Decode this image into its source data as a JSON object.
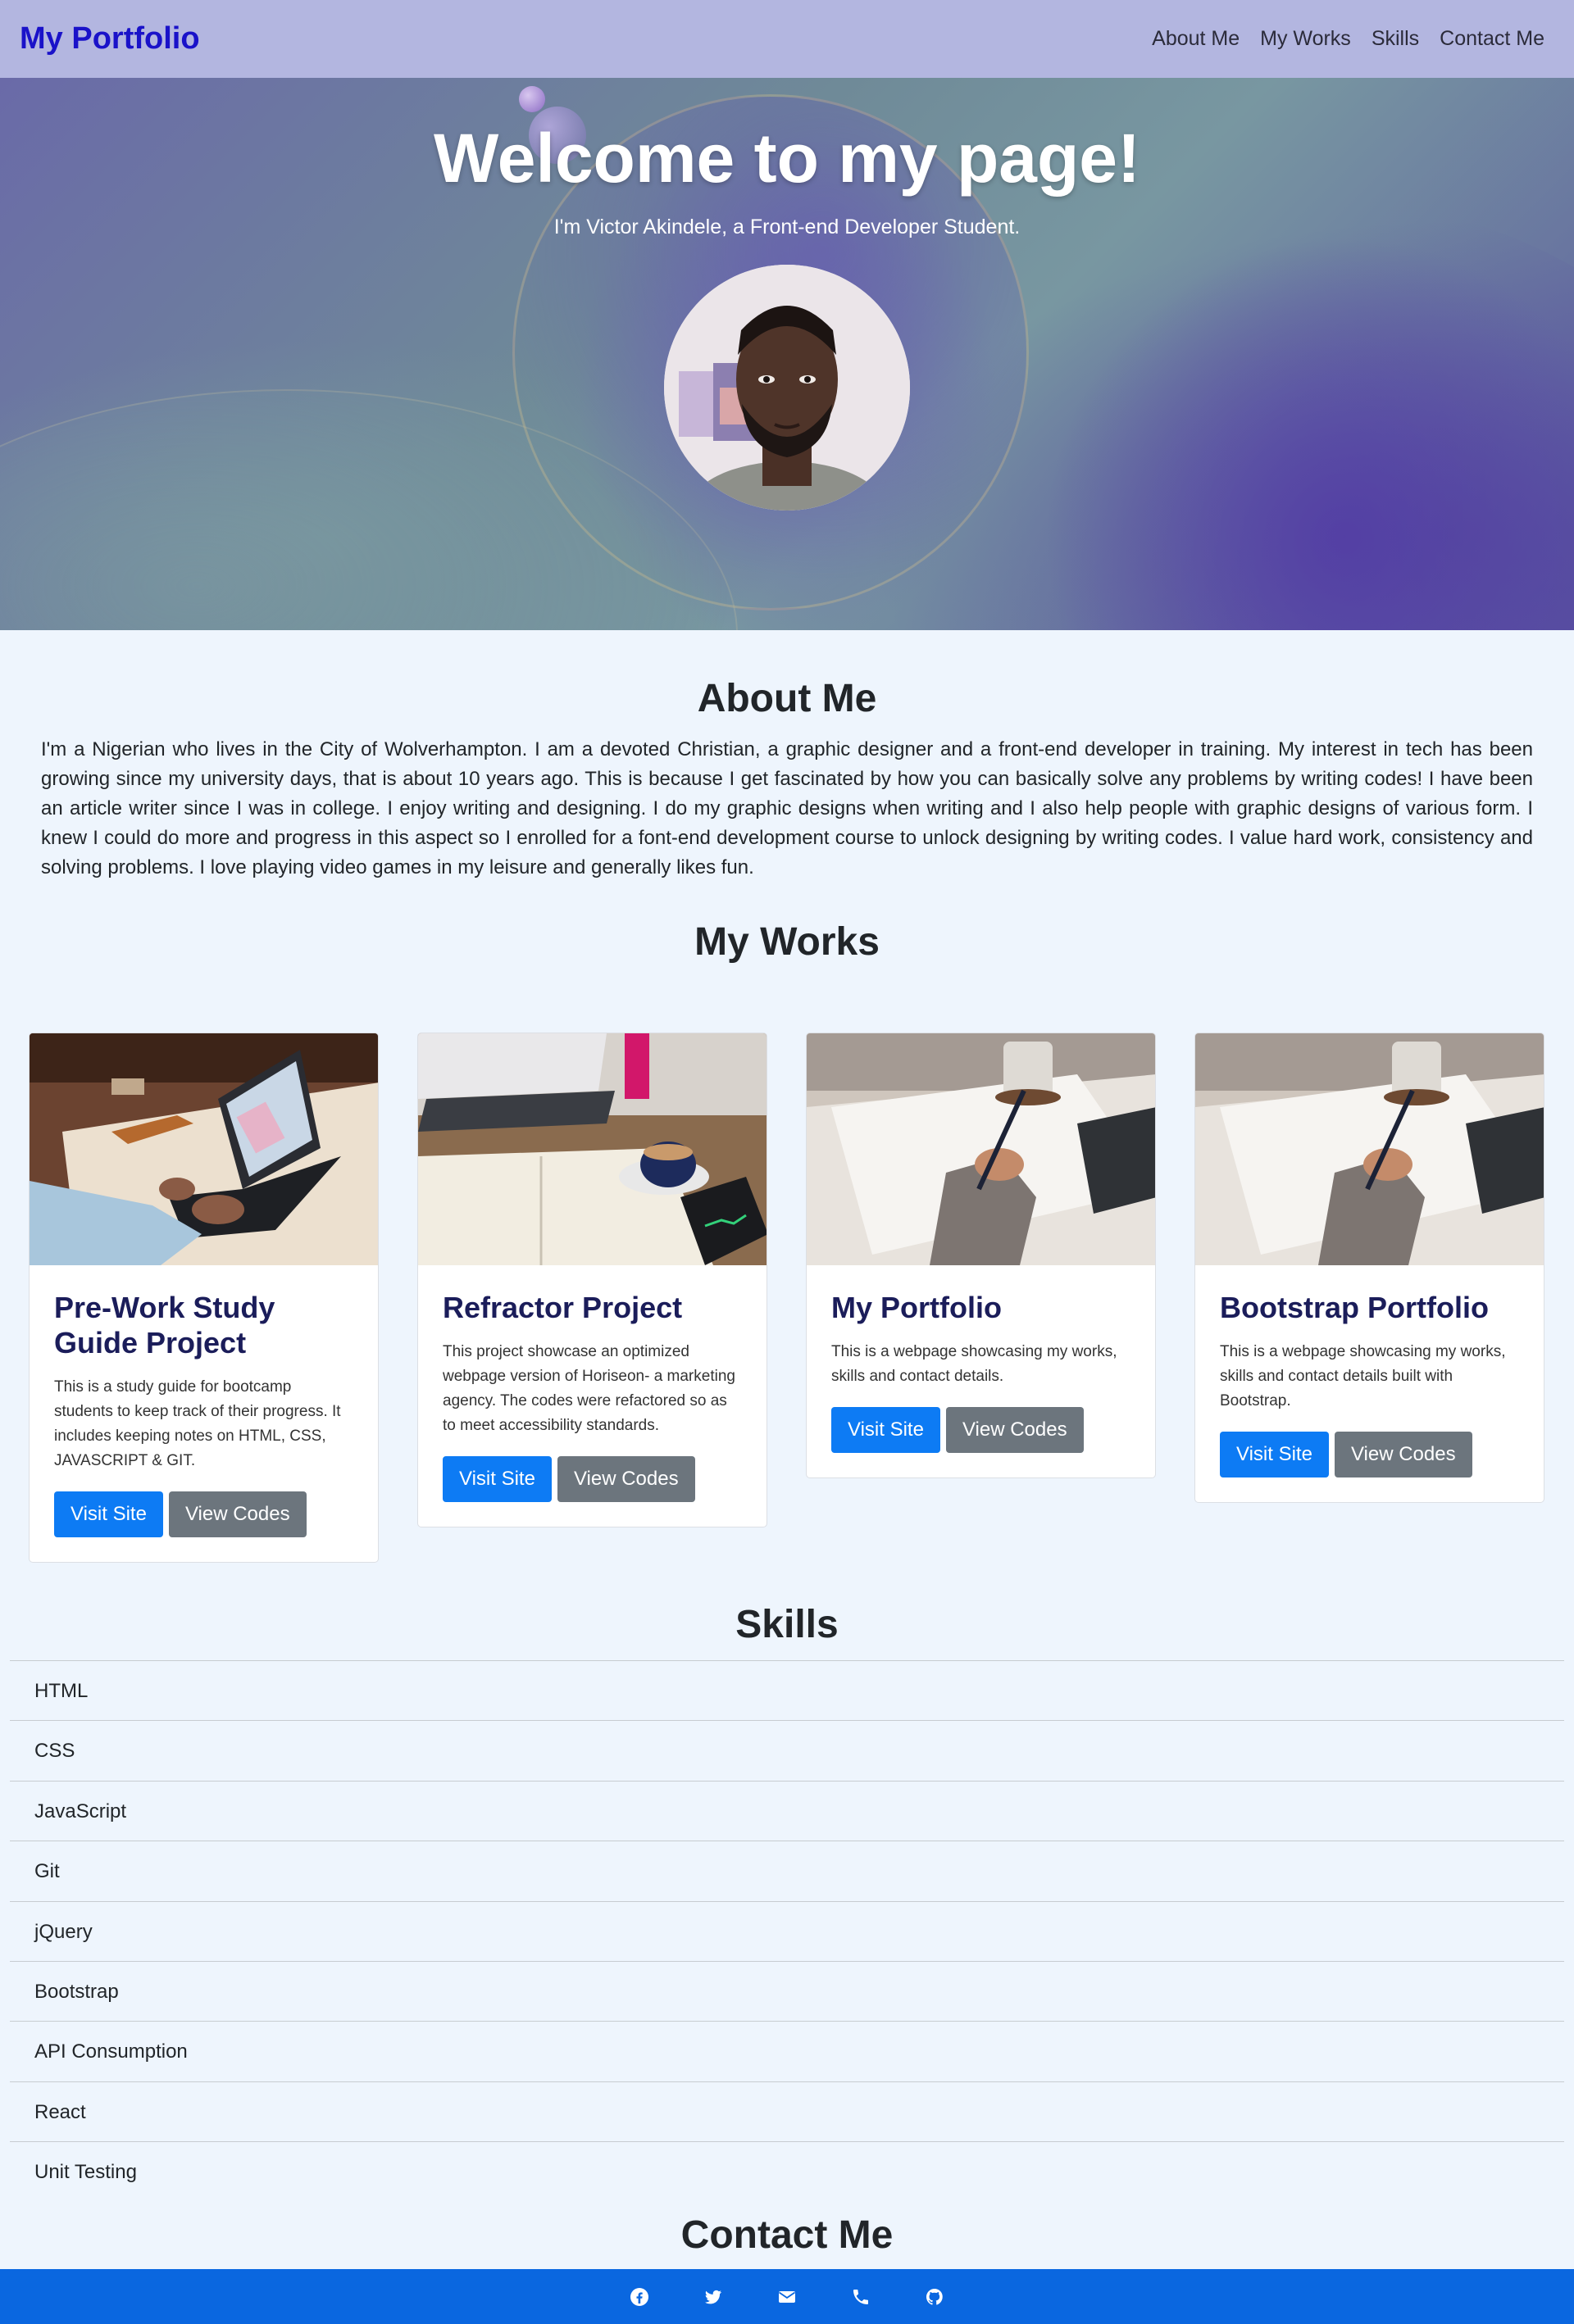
{
  "navbar": {
    "brand": "My Portfolio",
    "links": [
      "About Me",
      "My Works",
      "Skills",
      "Contact Me"
    ]
  },
  "hero": {
    "title": "Welcome to my page!",
    "subtitle": "I'm Victor Akindele, a Front-end Developer Student."
  },
  "about": {
    "title": "About Me",
    "text": "I'm a Nigerian who lives in the City of Wolverhampton. I am a devoted Christian, a graphic designer and a front-end developer in training. My interest in tech has been growing since my university days, that is about 10 years ago. This is because I get fascinated by how you can basically solve any problems by writing codes! I have been an article writer since I was in college. I enjoy writing and designing. I do my graphic designs when writing and I also help people with graphic designs of various form. I knew I could do more and progress in this aspect so I enrolled for a font-end development course to unlock designing by writing codes. I value hard work, consistency and solving problems. I love playing video games in my leisure and generally likes fun."
  },
  "works": {
    "title": "My Works",
    "projects": [
      {
        "title": "Pre-Work Study Guide Project",
        "description": "This is a study guide for bootcamp students to keep track of their progress. It includes keeping notes on HTML, CSS, JAVASCRIPT & GIT.",
        "visit_label": "Visit Site",
        "code_label": "View Codes"
      },
      {
        "title": "Refractor Project",
        "description": "This project showcase an optimized webpage version of Horiseon- a marketing agency. The codes were refactored so as to meet accessibility standards.",
        "visit_label": "Visit Site",
        "code_label": "View Codes"
      },
      {
        "title": "My Portfolio",
        "description": "This is a webpage showcasing my works, skills and contact details.",
        "visit_label": "Visit Site",
        "code_label": "View Codes"
      },
      {
        "title": "Bootstrap Portfolio",
        "description": "This is a webpage showcasing my works, skills and contact details built with Bootstrap.",
        "visit_label": "Visit Site",
        "code_label": "View Codes"
      }
    ]
  },
  "skills": {
    "title": "Skills",
    "items": [
      "HTML",
      "CSS",
      "JavaScript",
      "Git",
      "jQuery",
      "Bootstrap",
      "API Consumption",
      "React",
      "Unit Testing"
    ]
  },
  "contact": {
    "title": "Contact Me"
  },
  "footer": {
    "icons": [
      "facebook-icon",
      "twitter-icon",
      "email-icon",
      "phone-icon",
      "github-icon"
    ]
  },
  "colors": {
    "navbar_bg": "#b3b6e0",
    "brand": "#1a12c9",
    "primary_button": "#0d7bf4",
    "secondary_button": "#6c757d",
    "footer_bg": "#0a67e0",
    "page_bg": "#eef5fd"
  }
}
